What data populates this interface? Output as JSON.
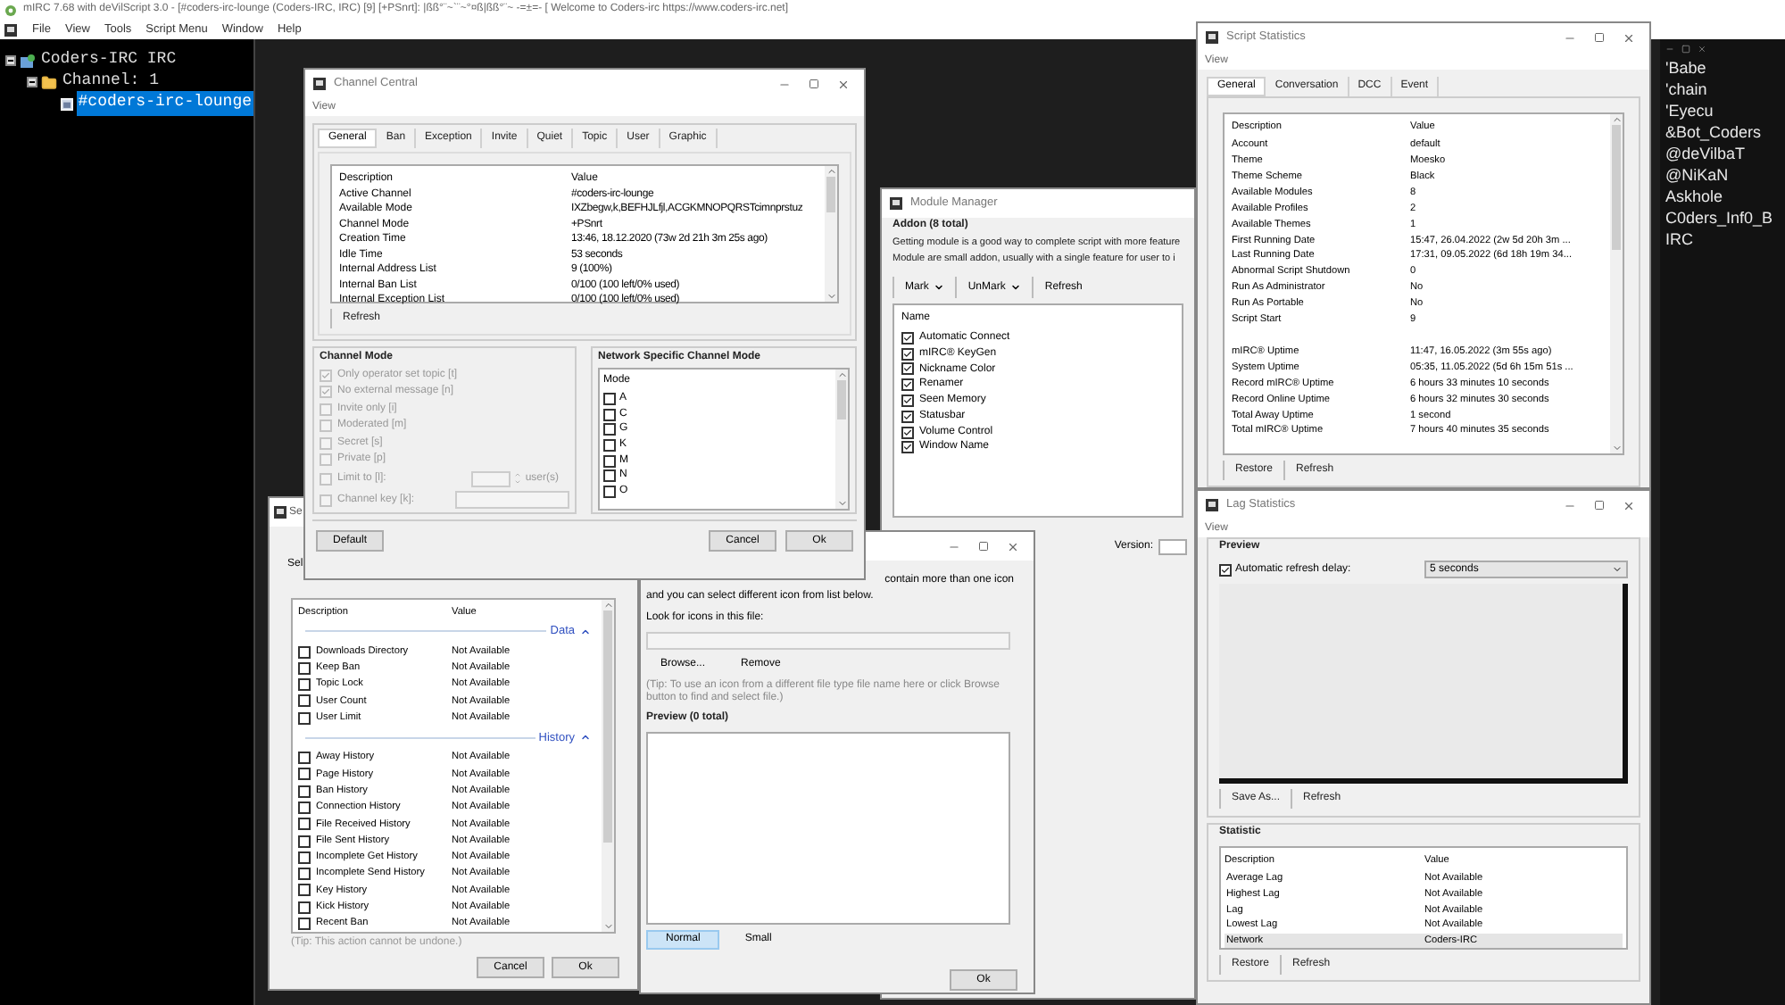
{
  "app": {
    "title": "mIRC 7.68 with deVilScript 3.0 - [#coders-irc-lounge (Coders-IRC, IRC) [9] [+PSnrt]: |ßß°¨~`¨~°¤ß|ßß°¨~ -=±=- [ Welcome to Coders-irc https://www.coders-irc.net]",
    "menu": [
      "File",
      "View",
      "Tools",
      "Script Menu",
      "Window",
      "Help"
    ],
    "tree": {
      "label": "Coders-IRC IRC",
      "expanded": true,
      "children": [
        {
          "label": "Channel: 1",
          "expanded": true,
          "children": [
            {
              "label": "#coders-irc-lounge",
              "selected": true
            }
          ]
        }
      ]
    },
    "nicklist": [
      "'Babe",
      "'chain",
      "'Eyecu",
      "&Bot_Coders",
      "@deVilbaT",
      "@NiKaN",
      "Askhole",
      "C0ders_Inf0_B",
      "IRC"
    ]
  },
  "channel_central": {
    "title": "Channel Central",
    "menu": "View",
    "tabs": [
      {
        "label": "General",
        "selected": true
      },
      {
        "label": "Ban",
        "selected": false
      },
      {
        "label": "Exception",
        "selected": false
      },
      {
        "label": "Invite",
        "selected": false
      },
      {
        "label": "Quiet",
        "selected": false
      },
      {
        "label": "Topic",
        "selected": false
      },
      {
        "label": "User",
        "selected": false
      },
      {
        "label": "Graphic",
        "selected": false
      }
    ],
    "columns": [
      "Description",
      "Value"
    ],
    "rows": [
      [
        "Active Channel",
        "#coders-irc-lounge"
      ],
      [
        "Available Mode",
        "IXZbegw,k,BEFHJLfjl,ACGKMNOPQRSTcimnprstuz"
      ],
      [
        "Channel Mode",
        "+PSnrt"
      ],
      [
        "Creation Time",
        "13:46, 18.12.2020 (73w 2d 21h 3m 25s ago)"
      ],
      [
        "Idle Time",
        "53 seconds"
      ],
      [
        "Internal Address List",
        "9 (100%)"
      ],
      [
        "Internal Ban List",
        "0/100 (100 left/0% used)"
      ],
      [
        "Internal Exception List",
        "0/100 (100 left/0% used)"
      ]
    ],
    "refresh": "Refresh",
    "mode_title": "Channel Mode",
    "modes": [
      {
        "kind": "plain",
        "label": "Only operator set topic [t]",
        "checked": true
      },
      {
        "kind": "plain",
        "label": "No external message [n]",
        "checked": true
      },
      {
        "kind": "plain",
        "label": "Invite only [i]",
        "checked": false
      },
      {
        "kind": "plain",
        "label": "Moderated [m]",
        "checked": false
      },
      {
        "kind": "plain",
        "label": "Secret [s]",
        "checked": false
      },
      {
        "kind": "plain",
        "label": "Private [p]",
        "checked": false
      },
      {
        "kind": "limit",
        "label": "Limit to [l]:",
        "checked": false,
        "suffix": "user(s)"
      },
      {
        "kind": "key",
        "label": "Channel key [k]:",
        "checked": false
      }
    ],
    "network_title": "Network Specific Channel Mode",
    "network_column": "Mode",
    "network_modes": [
      {
        "label": "A",
        "checked": false
      },
      {
        "label": "C",
        "checked": false
      },
      {
        "label": "G",
        "checked": false
      },
      {
        "label": "K",
        "checked": false
      },
      {
        "label": "M",
        "checked": false
      },
      {
        "label": "N",
        "checked": false
      },
      {
        "label": "O",
        "checked": false
      }
    ],
    "buttons": [
      "Default",
      "Cancel",
      "Ok"
    ]
  },
  "script_statistics": {
    "title": "Script Statistics",
    "menu": "View",
    "tabs": [
      {
        "label": "General",
        "selected": true
      },
      {
        "label": "Conversation",
        "selected": false
      },
      {
        "label": "DCC",
        "selected": false
      },
      {
        "label": "Event",
        "selected": false
      }
    ],
    "columns": [
      "Description",
      "Value"
    ],
    "rows": [
      [
        "Account",
        "default"
      ],
      [
        "Theme",
        "Moesko"
      ],
      [
        "Theme Scheme",
        "Black"
      ],
      [
        "Available Modules",
        "8"
      ],
      [
        "Available Profiles",
        "2"
      ],
      [
        "Available Themes",
        "1"
      ],
      [
        "First Running Date",
        "15:47, 26.04.2022 (2w 5d 20h 3m ..."
      ],
      [
        "Last Running Date",
        "17:31, 09.05.2022 (6d 18h 19m 34..."
      ],
      [
        "Abnormal Script Shutdown",
        "0"
      ],
      [
        "Run As Administrator",
        "No"
      ],
      [
        "Run As Portable",
        "No"
      ],
      [
        "Script Start",
        "9"
      ]
    ],
    "uptime_rows": [
      [
        "mIRC® Uptime",
        "11:47, 16.05.2022 (3m 55s ago)"
      ],
      [
        "System Uptime",
        "05:35, 11.05.2022 (5d 6h 15m 51s ..."
      ],
      [
        "Record mIRC® Uptime",
        "6 hours 33 minutes 10 seconds"
      ],
      [
        "Record Online Uptime",
        "6 hours 32 minutes 30 seconds"
      ],
      [
        "Total Away Uptime",
        "1 second"
      ],
      [
        "Total mIRC® Uptime",
        "7 hours 40 minutes 35 seconds"
      ]
    ],
    "buttons": [
      "Restore",
      "Refresh"
    ]
  },
  "lag_statistics": {
    "title": "Lag Statistics",
    "menu": "View",
    "preview_title": "Preview",
    "auto_refresh": {
      "label": "Automatic refresh delay:",
      "checked": true
    },
    "delay": "5 seconds",
    "preview_buttons": [
      "Save As...",
      "Refresh"
    ],
    "statistic_title": "Statistic",
    "columns": [
      "Description",
      "Value"
    ],
    "rows": [
      {
        "description": "Average Lag",
        "value": "Not Available",
        "selected": false
      },
      {
        "description": "Highest Lag",
        "value": "Not Available",
        "selected": false
      },
      {
        "description": "Lag",
        "value": "Not Available",
        "selected": false
      },
      {
        "description": "Lowest Lag",
        "value": "Not Available",
        "selected": false
      },
      {
        "description": "Network",
        "value": "Coders-IRC",
        "selected": true
      }
    ],
    "buttons": [
      "Restore",
      "Refresh"
    ]
  },
  "module_manager": {
    "title": "Module Manager",
    "group_title": "Addon (8 total)",
    "description": [
      "Getting module is a good way to complete script with more feature",
      "Module are small addon, usually with a single feature for user to i"
    ],
    "toolbar": [
      {
        "label": "Mark",
        "kind": "dropdown"
      },
      {
        "label": "UnMark",
        "kind": "dropdown"
      },
      {
        "label": "Refresh",
        "kind": "button"
      }
    ],
    "column": "Name",
    "modules": [
      {
        "name": "Automatic Connect",
        "checked": true
      },
      {
        "name": "mIRC® KeyGen",
        "checked": true
      },
      {
        "name": "Nickname Color",
        "checked": true
      },
      {
        "name": "Renamer",
        "checked": true
      },
      {
        "name": "Seen Memory",
        "checked": true
      },
      {
        "name": "Statusbar",
        "checked": true
      },
      {
        "name": "Volume Control",
        "checked": true
      },
      {
        "name": "Window Name",
        "checked": true
      }
    ],
    "version_label": "Version:"
  },
  "icon_dialog": {
    "description": [
      "contain more than one icon",
      "and you can select different icon from list below."
    ],
    "file_label": "Look for icons in this file:",
    "buttons": [
      "Browse...",
      "Remove"
    ],
    "tip": "(Tip: To use an icon from a different file type file name here or click Browse button to find and select file.)",
    "preview_title": "Preview (0 total)",
    "sizes": [
      {
        "label": "Normal",
        "selected": true
      },
      {
        "label": "Small",
        "selected": false
      }
    ],
    "ok": "Ok"
  },
  "left_dialog": {
    "title": "Se",
    "label": "Sel",
    "columns": [
      "Description",
      "Value"
    ],
    "sections": [
      {
        "title": "Data",
        "expanded": true,
        "rows": [
          {
            "name": "Downloads Directory",
            "value": "Not Available",
            "checked": false
          },
          {
            "name": "Keep Ban",
            "value": "Not Available",
            "checked": false
          },
          {
            "name": "Topic Lock",
            "value": "Not Available",
            "checked": false
          },
          {
            "name": "User Count",
            "value": "Not Available",
            "checked": false
          },
          {
            "name": "User Limit",
            "value": "Not Available",
            "checked": false
          }
        ]
      },
      {
        "title": "History",
        "expanded": true,
        "rows": [
          {
            "name": "Away History",
            "value": "Not Available",
            "checked": false
          },
          {
            "name": "Page History",
            "value": "Not Available",
            "checked": false
          },
          {
            "name": "Ban History",
            "value": "Not Available",
            "checked": false
          },
          {
            "name": "Connection History",
            "value": "Not Available",
            "checked": false
          },
          {
            "name": "File Received History",
            "value": "Not Available",
            "checked": false
          },
          {
            "name": "File Sent History",
            "value": "Not Available",
            "checked": false
          },
          {
            "name": "Incomplete Get History",
            "value": "Not Available",
            "checked": false
          },
          {
            "name": "Incomplete Send History",
            "value": "Not Available",
            "checked": false
          },
          {
            "name": "Key History",
            "value": "Not Available",
            "checked": false
          },
          {
            "name": "Kick History",
            "value": "Not Available",
            "checked": false
          },
          {
            "name": "Recent Ban",
            "value": "Not Available",
            "checked": false
          }
        ]
      }
    ],
    "tip": "(Tip: This action cannot be undone.)",
    "buttons": [
      "Cancel",
      "Ok"
    ]
  }
}
